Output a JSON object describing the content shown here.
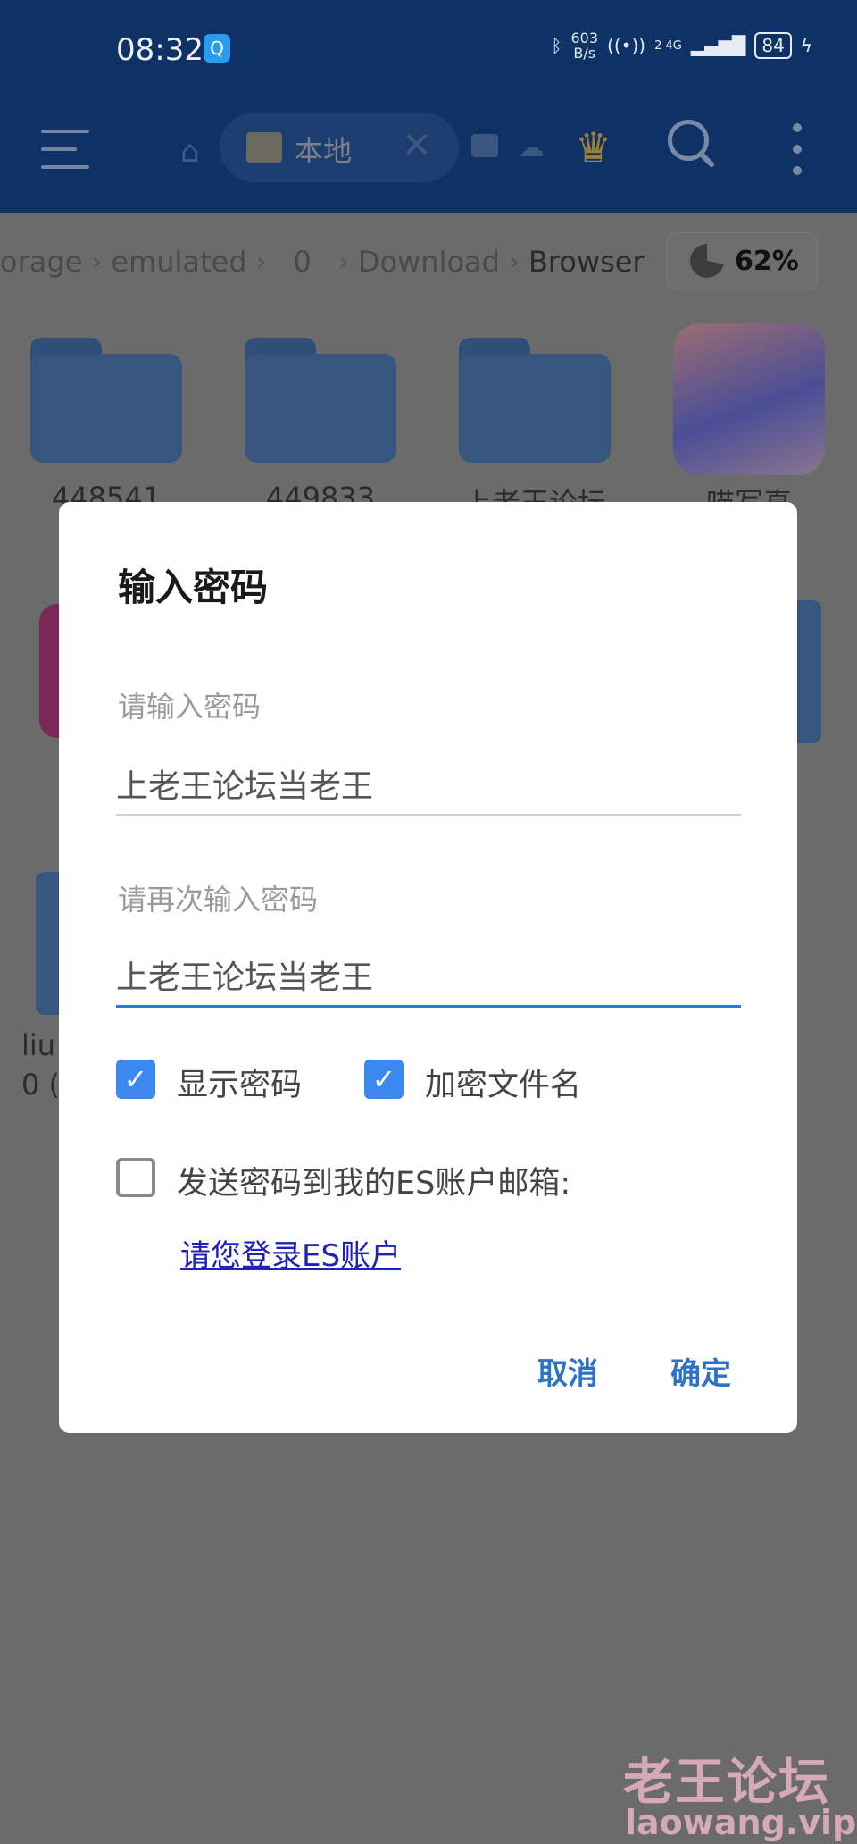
{
  "status_bar": {
    "time": "08:32",
    "net_speed_value": "603",
    "net_speed_unit": "B/s",
    "signal_label": "2 4G",
    "battery": "84",
    "icons": [
      "search-app-icon",
      "bluetooth-icon",
      "hotspot-icon",
      "signal-icon",
      "battery-icon",
      "charging-icon"
    ]
  },
  "toolbar": {
    "active_tab": "本地",
    "icons": [
      "menu-icon",
      "home-icon",
      "sd-card-icon",
      "close-icon",
      "window-icon",
      "cloud-icon",
      "crown-icon",
      "search-icon",
      "more-icon"
    ],
    "crown_color": "#9b8138"
  },
  "breadcrumb": {
    "items": [
      "orage",
      "emulated",
      "0",
      "Download",
      "Browser"
    ],
    "storage_used": "62%"
  },
  "files": {
    "items": [
      {
        "name": "448541",
        "type": "folder"
      },
      {
        "name": "449833",
        "type": "folder"
      },
      {
        "name": "上老王论坛",
        "type": "folder"
      },
      {
        "name": "喵写真",
        "type": "app"
      }
    ],
    "partial_label_1": "liu",
    "partial_label_2": "0 ("
  },
  "dialog": {
    "title": "输入密码",
    "password_label": "请输入密码",
    "password_value": "上老王论坛当老王",
    "confirm_label": "请再次输入密码",
    "confirm_value": "上老王论坛当老王",
    "show_password": {
      "label": "显示密码",
      "checked": true
    },
    "encrypt_filename": {
      "label": "加密文件名",
      "checked": true
    },
    "send_email": {
      "label": "发送密码到我的ES账户邮箱:",
      "checked": false
    },
    "login_link": "请您登录ES账户",
    "cancel": "取消",
    "ok": "确定",
    "accent_color": "#3b88ee"
  },
  "watermark": {
    "title": "老王论坛",
    "url": "laowang.vip"
  }
}
